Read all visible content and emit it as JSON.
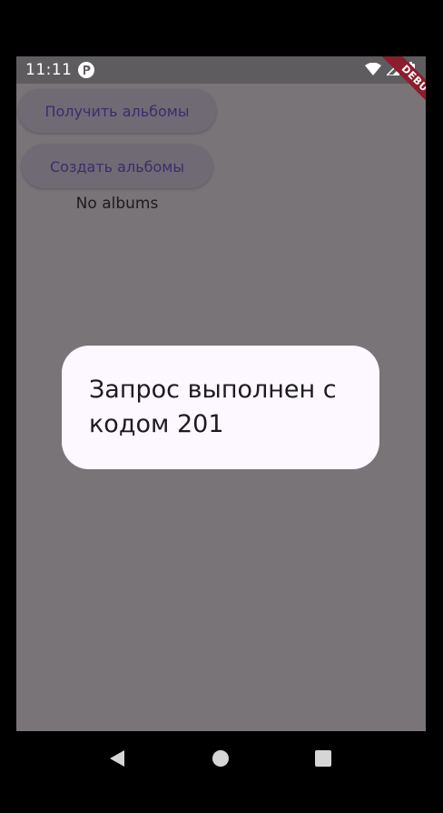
{
  "status_bar": {
    "time": "11:11",
    "icons": [
      "app-notification-icon",
      "wifi-icon",
      "signal-icon",
      "battery-icon"
    ]
  },
  "debug_banner": "DEBUG",
  "buttons": {
    "get_albums": "Получить альбомы",
    "create_albums": "Создать альбомы"
  },
  "empty_state": "No albums",
  "dialog": {
    "message": "Запрос выполнен с кодом 201"
  },
  "navigation": {
    "icons": [
      "back-icon",
      "home-icon",
      "recents-icon"
    ]
  },
  "colors": {
    "scrim_background": "#787478",
    "dialog_background": "#fdf7ff",
    "button_text": "#3a2e6b",
    "debug_banner": "#8b1e2c"
  }
}
